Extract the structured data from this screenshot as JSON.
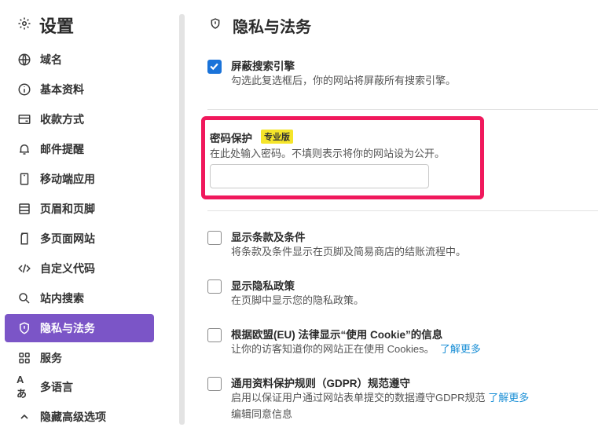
{
  "sidebar": {
    "title": "设置",
    "items": [
      {
        "label": "域名",
        "icon": "globe-icon"
      },
      {
        "label": "基本资料",
        "icon": "info-icon"
      },
      {
        "label": "收款方式",
        "icon": "wallet-icon"
      },
      {
        "label": "邮件提醒",
        "icon": "bell-icon"
      },
      {
        "label": "移动端应用",
        "icon": "mobile-icon"
      },
      {
        "label": "页眉和页脚",
        "icon": "layout-icon"
      },
      {
        "label": "多页面网站",
        "icon": "pages-icon"
      },
      {
        "label": "自定义代码",
        "icon": "code-icon"
      },
      {
        "label": "站内搜索",
        "icon": "search-icon"
      },
      {
        "label": "隐私与法务",
        "icon": "shield-icon",
        "active": true
      },
      {
        "label": "服务",
        "icon": "grid-icon"
      },
      {
        "label": "多语言",
        "icon": "language-icon"
      },
      {
        "label": "隐藏高级选项",
        "icon": "chevron-up-icon"
      }
    ]
  },
  "main": {
    "title": "隐私与法务",
    "block_search": {
      "label": "屏蔽搜索引擎",
      "desc": "勾选此复选框后，你的网站将屏蔽所有搜索引擎。",
      "checked": true
    },
    "password": {
      "label": "密码保护",
      "badge": "专业版",
      "desc": "在此处输入密码。不填则表示将你的网站设为公开。",
      "value": "",
      "placeholder": ""
    },
    "terms": {
      "label": "显示条款及条件",
      "desc": "将条款及条件显示在页脚及简易商店的结账流程中。",
      "checked": false
    },
    "privacy": {
      "label": "显示隐私政策",
      "desc": "在页脚中显示您的隐私政策。",
      "checked": false
    },
    "cookie": {
      "label": "根据欧盟(EU) 法律显示“使用 Cookie”的信息",
      "desc": "让你的访客知道你的网站正在使用 Cookies。",
      "link": "了解更多",
      "checked": false
    },
    "gdpr": {
      "label": "通用资料保护规则（GDPR）规范遵守",
      "desc": "启用以保证用户通过网站表单提交的数据遵守GDPR规范",
      "link": "了解更多",
      "link2": "编辑同意信息",
      "checked": false
    }
  },
  "colors": {
    "accent": "#7b55c7",
    "checkbox": "#1a73d9",
    "highlight": "#f0185c",
    "badge": "#f5e52a",
    "link": "#1a8fd6"
  }
}
